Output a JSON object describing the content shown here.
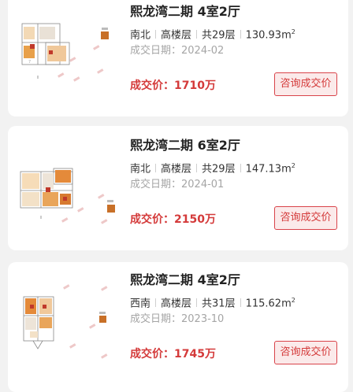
{
  "listings": [
    {
      "title": "熙龙湾二期 4室2厅",
      "orientation": "南北",
      "floor_level": "高楼层",
      "total_floors": "共29层",
      "area": "130.93",
      "area_unit": "m",
      "area_sup": "2",
      "deal_date": "成交日期：2024-02",
      "price_label": "成交价：",
      "price": "1710万",
      "button_label": "咨询成交价"
    },
    {
      "title": "熙龙湾二期 6室2厅",
      "orientation": "南北",
      "floor_level": "高楼层",
      "total_floors": "共29层",
      "area": "147.13",
      "area_unit": "m",
      "area_sup": "2",
      "deal_date": "成交日期：2024-01",
      "price_label": "成交价：",
      "price": "2150万",
      "button_label": "咨询成交价"
    },
    {
      "title": "熙龙湾二期 4室2厅",
      "orientation": "西南",
      "floor_level": "高楼层",
      "total_floors": "共31层",
      "area": "115.62",
      "area_unit": "m",
      "area_sup": "2",
      "deal_date": "成交日期：2023-10",
      "price_label": "成交价：",
      "price": "1745万",
      "button_label": "咨询成交价"
    }
  ],
  "colors": {
    "accent": "#d43a3a",
    "button_bg": "#fbeaea",
    "date_gray": "#a5a5a5",
    "background": "#f2f2f2"
  }
}
